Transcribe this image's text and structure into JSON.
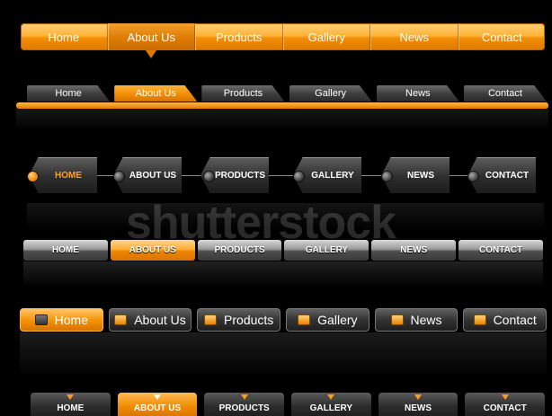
{
  "row1": {
    "items": [
      "Home",
      "About Us",
      "Products",
      "Gallery",
      "News",
      "Contact"
    ],
    "active": 1
  },
  "row2": {
    "items": [
      "Home",
      "About Us",
      "Products",
      "Gallery",
      "News",
      "Contact"
    ],
    "active": 1
  },
  "row3": {
    "items": [
      "HOME",
      "ABOUT US",
      "PRODUCTS",
      "GALLERY",
      "NEWS",
      "CONTACT"
    ],
    "active": 0
  },
  "row4": {
    "items": [
      "HOME",
      "ABOUT US",
      "PRODUCTS",
      "GALLERY",
      "NEWS",
      "CONTACT"
    ],
    "active": 1
  },
  "row5": {
    "items": [
      "Home",
      "About Us",
      "Products",
      "Gallery",
      "News",
      "Contact"
    ],
    "active": 0
  },
  "row6": {
    "items": [
      "HOME",
      "ABOUT US",
      "PRODUCTS",
      "GALLERY",
      "NEWS",
      "CONTACT"
    ],
    "active": 1
  },
  "watermark": "shutterstock",
  "colors": {
    "accent": "#f28d05",
    "background": "#000000"
  }
}
